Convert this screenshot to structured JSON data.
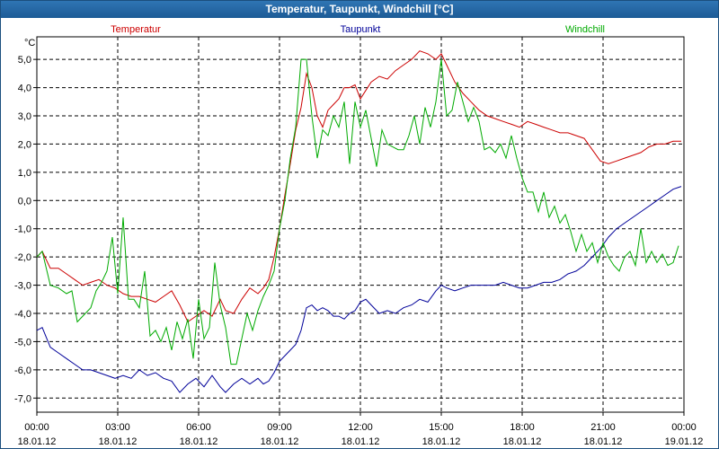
{
  "window": {
    "title": "Temperatur, Taupunkt, Windchill [°C]"
  },
  "chart_data": {
    "type": "line",
    "title": "Temperatur, Taupunkt, Windchill [°C]",
    "ylabel": "°C",
    "ylim": [
      -7.5,
      5.8
    ],
    "yticks": [
      {
        "v": 5,
        "label": "5,0"
      },
      {
        "v": 4,
        "label": "4,0"
      },
      {
        "v": 3,
        "label": "3,0"
      },
      {
        "v": 2,
        "label": "2,0"
      },
      {
        "v": 1,
        "label": "1,0"
      },
      {
        "v": 0,
        "label": "0,0"
      },
      {
        "v": -1,
        "label": "-1,0"
      },
      {
        "v": -2,
        "label": "-2,0"
      },
      {
        "v": -3,
        "label": "-3,0"
      },
      {
        "v": -4,
        "label": "-4,0"
      },
      {
        "v": -5,
        "label": "-5,0"
      },
      {
        "v": -6,
        "label": "-6,0"
      },
      {
        "v": -7,
        "label": "-7,0"
      }
    ],
    "xlim": [
      0,
      24
    ],
    "xticks": [
      {
        "v": 0,
        "time": "00:00",
        "date": "18.01.12"
      },
      {
        "v": 3,
        "time": "03:00",
        "date": "18.01.12"
      },
      {
        "v": 6,
        "time": "06:00",
        "date": "18.01.12"
      },
      {
        "v": 9,
        "time": "09:00",
        "date": "18.01.12"
      },
      {
        "v": 12,
        "time": "12:00",
        "date": "18.01.12"
      },
      {
        "v": 15,
        "time": "15:00",
        "date": "18.01.12"
      },
      {
        "v": 18,
        "time": "18:00",
        "date": "18.01.12"
      },
      {
        "v": 21,
        "time": "21:00",
        "date": "18.01.12"
      },
      {
        "v": 24,
        "time": "00:00",
        "date": "19.01.12"
      }
    ],
    "grid": true,
    "legend": "top",
    "series": [
      {
        "name": "Temperatur",
        "color": "#cc0000",
        "points": [
          [
            0,
            -2.0
          ],
          [
            0.2,
            -1.8
          ],
          [
            0.5,
            -2.4
          ],
          [
            0.8,
            -2.4
          ],
          [
            1.1,
            -2.6
          ],
          [
            1.4,
            -2.8
          ],
          [
            1.7,
            -3.0
          ],
          [
            2.0,
            -2.9
          ],
          [
            2.3,
            -2.8
          ],
          [
            2.6,
            -3.0
          ],
          [
            2.9,
            -3.1
          ],
          [
            3.2,
            -3.3
          ],
          [
            3.5,
            -3.4
          ],
          [
            3.8,
            -3.4
          ],
          [
            4.1,
            -3.5
          ],
          [
            4.4,
            -3.6
          ],
          [
            4.7,
            -3.4
          ],
          [
            5.0,
            -3.2
          ],
          [
            5.3,
            -3.7
          ],
          [
            5.6,
            -4.3
          ],
          [
            5.9,
            -4.1
          ],
          [
            6.2,
            -3.9
          ],
          [
            6.5,
            -4.1
          ],
          [
            6.8,
            -3.5
          ],
          [
            7.0,
            -3.9
          ],
          [
            7.3,
            -4.0
          ],
          [
            7.6,
            -3.5
          ],
          [
            7.9,
            -3.1
          ],
          [
            8.2,
            -3.3
          ],
          [
            8.4,
            -3.1
          ],
          [
            8.6,
            -2.8
          ],
          [
            8.8,
            -2.0
          ],
          [
            9.0,
            -1.0
          ],
          [
            9.2,
            0.2
          ],
          [
            9.4,
            1.3
          ],
          [
            9.6,
            2.5
          ],
          [
            9.8,
            3.3
          ],
          [
            10.0,
            4.5
          ],
          [
            10.2,
            4.0
          ],
          [
            10.4,
            3.0
          ],
          [
            10.6,
            2.6
          ],
          [
            10.8,
            3.2
          ],
          [
            11.0,
            3.4
          ],
          [
            11.2,
            3.6
          ],
          [
            11.4,
            4.0
          ],
          [
            11.6,
            4.0
          ],
          [
            11.8,
            4.1
          ],
          [
            12.0,
            3.6
          ],
          [
            12.2,
            3.9
          ],
          [
            12.4,
            4.2
          ],
          [
            12.7,
            4.4
          ],
          [
            13.0,
            4.3
          ],
          [
            13.3,
            4.6
          ],
          [
            13.6,
            4.8
          ],
          [
            13.9,
            5.0
          ],
          [
            14.2,
            5.3
          ],
          [
            14.5,
            5.2
          ],
          [
            14.8,
            5.0
          ],
          [
            15.0,
            5.2
          ],
          [
            15.2,
            4.8
          ],
          [
            15.5,
            4.2
          ],
          [
            15.8,
            3.8
          ],
          [
            16.1,
            3.5
          ],
          [
            16.4,
            3.2
          ],
          [
            16.7,
            3.0
          ],
          [
            17.0,
            2.9
          ],
          [
            17.3,
            2.8
          ],
          [
            17.6,
            2.7
          ],
          [
            17.9,
            2.6
          ],
          [
            18.2,
            2.8
          ],
          [
            18.5,
            2.7
          ],
          [
            18.8,
            2.6
          ],
          [
            19.1,
            2.5
          ],
          [
            19.4,
            2.4
          ],
          [
            19.7,
            2.4
          ],
          [
            20.0,
            2.3
          ],
          [
            20.3,
            2.2
          ],
          [
            20.6,
            1.8
          ],
          [
            20.9,
            1.4
          ],
          [
            21.2,
            1.3
          ],
          [
            21.5,
            1.4
          ],
          [
            21.8,
            1.5
          ],
          [
            22.1,
            1.6
          ],
          [
            22.4,
            1.7
          ],
          [
            22.7,
            1.9
          ],
          [
            23.0,
            2.0
          ],
          [
            23.3,
            2.0
          ],
          [
            23.6,
            2.1
          ],
          [
            23.9,
            2.1
          ]
        ]
      },
      {
        "name": "Taupunkt",
        "color": "#000099",
        "points": [
          [
            0,
            -4.6
          ],
          [
            0.2,
            -4.5
          ],
          [
            0.5,
            -5.2
          ],
          [
            0.8,
            -5.4
          ],
          [
            1.1,
            -5.6
          ],
          [
            1.4,
            -5.8
          ],
          [
            1.7,
            -6.0
          ],
          [
            2.0,
            -6.0
          ],
          [
            2.3,
            -6.1
          ],
          [
            2.6,
            -6.2
          ],
          [
            2.9,
            -6.3
          ],
          [
            3.2,
            -6.2
          ],
          [
            3.5,
            -6.3
          ],
          [
            3.8,
            -6.0
          ],
          [
            4.1,
            -6.2
          ],
          [
            4.4,
            -6.1
          ],
          [
            4.7,
            -6.3
          ],
          [
            5.0,
            -6.4
          ],
          [
            5.3,
            -6.8
          ],
          [
            5.6,
            -6.5
          ],
          [
            5.9,
            -6.3
          ],
          [
            6.2,
            -6.6
          ],
          [
            6.5,
            -6.2
          ],
          [
            6.8,
            -6.6
          ],
          [
            7.0,
            -6.8
          ],
          [
            7.3,
            -6.5
          ],
          [
            7.6,
            -6.3
          ],
          [
            7.9,
            -6.5
          ],
          [
            8.2,
            -6.3
          ],
          [
            8.4,
            -6.5
          ],
          [
            8.6,
            -6.4
          ],
          [
            8.8,
            -6.1
          ],
          [
            9.0,
            -5.7
          ],
          [
            9.2,
            -5.5
          ],
          [
            9.4,
            -5.3
          ],
          [
            9.6,
            -5.1
          ],
          [
            9.8,
            -4.6
          ],
          [
            10.0,
            -3.8
          ],
          [
            10.2,
            -3.7
          ],
          [
            10.4,
            -3.9
          ],
          [
            10.6,
            -3.8
          ],
          [
            10.8,
            -3.9
          ],
          [
            11.0,
            -4.1
          ],
          [
            11.2,
            -4.1
          ],
          [
            11.4,
            -4.2
          ],
          [
            11.6,
            -4.0
          ],
          [
            11.8,
            -3.9
          ],
          [
            12.0,
            -3.6
          ],
          [
            12.2,
            -3.5
          ],
          [
            12.4,
            -3.7
          ],
          [
            12.7,
            -4.0
          ],
          [
            13.0,
            -3.9
          ],
          [
            13.3,
            -4.0
          ],
          [
            13.6,
            -3.8
          ],
          [
            13.9,
            -3.7
          ],
          [
            14.2,
            -3.5
          ],
          [
            14.5,
            -3.6
          ],
          [
            14.8,
            -3.2
          ],
          [
            15.0,
            -3.0
          ],
          [
            15.2,
            -3.1
          ],
          [
            15.5,
            -3.2
          ],
          [
            15.8,
            -3.1
          ],
          [
            16.1,
            -3.0
          ],
          [
            16.4,
            -3.0
          ],
          [
            16.7,
            -3.0
          ],
          [
            17.0,
            -3.0
          ],
          [
            17.3,
            -2.9
          ],
          [
            17.6,
            -3.0
          ],
          [
            17.9,
            -3.1
          ],
          [
            18.2,
            -3.1
          ],
          [
            18.5,
            -3.0
          ],
          [
            18.8,
            -2.9
          ],
          [
            19.1,
            -2.9
          ],
          [
            19.4,
            -2.8
          ],
          [
            19.7,
            -2.6
          ],
          [
            20.0,
            -2.5
          ],
          [
            20.3,
            -2.3
          ],
          [
            20.6,
            -2.0
          ],
          [
            20.9,
            -1.7
          ],
          [
            21.2,
            -1.3
          ],
          [
            21.5,
            -1.0
          ],
          [
            21.8,
            -0.8
          ],
          [
            22.1,
            -0.6
          ],
          [
            22.4,
            -0.4
          ],
          [
            22.7,
            -0.2
          ],
          [
            23.0,
            0.0
          ],
          [
            23.3,
            0.2
          ],
          [
            23.6,
            0.4
          ],
          [
            23.9,
            0.5
          ]
        ]
      },
      {
        "name": "Windchill",
        "color": "#00aa00",
        "points": [
          [
            0,
            -2.0
          ],
          [
            0.2,
            -1.8
          ],
          [
            0.5,
            -3.0
          ],
          [
            0.8,
            -3.1
          ],
          [
            1.1,
            -3.3
          ],
          [
            1.3,
            -3.2
          ],
          [
            1.5,
            -4.3
          ],
          [
            1.8,
            -4.0
          ],
          [
            2.0,
            -3.8
          ],
          [
            2.2,
            -3.2
          ],
          [
            2.4,
            -2.9
          ],
          [
            2.6,
            -2.5
          ],
          [
            2.8,
            -1.3
          ],
          [
            3.0,
            -3.3
          ],
          [
            3.2,
            -0.6
          ],
          [
            3.4,
            -3.5
          ],
          [
            3.6,
            -3.5
          ],
          [
            3.8,
            -3.8
          ],
          [
            4.0,
            -2.5
          ],
          [
            4.2,
            -4.8
          ],
          [
            4.4,
            -4.6
          ],
          [
            4.6,
            -5.0
          ],
          [
            4.8,
            -4.5
          ],
          [
            5.0,
            -5.3
          ],
          [
            5.2,
            -4.3
          ],
          [
            5.4,
            -4.9
          ],
          [
            5.6,
            -4.2
          ],
          [
            5.8,
            -5.6
          ],
          [
            6.0,
            -3.5
          ],
          [
            6.2,
            -4.9
          ],
          [
            6.4,
            -4.5
          ],
          [
            6.6,
            -2.2
          ],
          [
            6.8,
            -3.7
          ],
          [
            7.0,
            -4.5
          ],
          [
            7.2,
            -5.8
          ],
          [
            7.4,
            -5.8
          ],
          [
            7.6,
            -4.9
          ],
          [
            7.8,
            -4.0
          ],
          [
            8.0,
            -4.6
          ],
          [
            8.2,
            -3.9
          ],
          [
            8.4,
            -3.4
          ],
          [
            8.6,
            -3.0
          ],
          [
            8.8,
            -2.5
          ],
          [
            9.0,
            -1.0
          ],
          [
            9.2,
            0.0
          ],
          [
            9.4,
            1.5
          ],
          [
            9.6,
            2.6
          ],
          [
            9.8,
            5.0
          ],
          [
            10.0,
            5.0
          ],
          [
            10.2,
            3.0
          ],
          [
            10.4,
            1.5
          ],
          [
            10.6,
            2.5
          ],
          [
            10.8,
            2.3
          ],
          [
            11.0,
            3.0
          ],
          [
            11.2,
            2.6
          ],
          [
            11.4,
            3.5
          ],
          [
            11.6,
            1.3
          ],
          [
            11.8,
            3.5
          ],
          [
            12.0,
            2.6
          ],
          [
            12.2,
            3.2
          ],
          [
            12.4,
            2.2
          ],
          [
            12.6,
            1.2
          ],
          [
            12.8,
            2.5
          ],
          [
            13.0,
            2.0
          ],
          [
            13.2,
            1.9
          ],
          [
            13.4,
            1.8
          ],
          [
            13.6,
            1.8
          ],
          [
            13.8,
            2.3
          ],
          [
            14.0,
            3.0
          ],
          [
            14.2,
            2.0
          ],
          [
            14.4,
            3.3
          ],
          [
            14.6,
            2.6
          ],
          [
            14.8,
            3.5
          ],
          [
            15.0,
            5.0
          ],
          [
            15.2,
            3.0
          ],
          [
            15.4,
            3.2
          ],
          [
            15.6,
            4.2
          ],
          [
            15.8,
            3.5
          ],
          [
            16.0,
            2.8
          ],
          [
            16.2,
            3.3
          ],
          [
            16.4,
            2.8
          ],
          [
            16.6,
            1.8
          ],
          [
            16.8,
            1.9
          ],
          [
            17.0,
            1.7
          ],
          [
            17.2,
            2.0
          ],
          [
            17.4,
            1.5
          ],
          [
            17.6,
            2.3
          ],
          [
            17.8,
            1.5
          ],
          [
            18.0,
            0.8
          ],
          [
            18.2,
            0.3
          ],
          [
            18.4,
            0.3
          ],
          [
            18.6,
            -0.4
          ],
          [
            18.8,
            0.3
          ],
          [
            19.0,
            -0.6
          ],
          [
            19.2,
            -0.2
          ],
          [
            19.4,
            -0.8
          ],
          [
            19.6,
            -0.5
          ],
          [
            19.8,
            -1.1
          ],
          [
            20.0,
            -1.8
          ],
          [
            20.2,
            -1.2
          ],
          [
            20.4,
            -1.8
          ],
          [
            20.6,
            -1.5
          ],
          [
            20.8,
            -2.2
          ],
          [
            21.0,
            -1.5
          ],
          [
            21.2,
            -2.0
          ],
          [
            21.4,
            -2.3
          ],
          [
            21.6,
            -2.5
          ],
          [
            21.8,
            -2.0
          ],
          [
            22.0,
            -1.8
          ],
          [
            22.2,
            -2.3
          ],
          [
            22.4,
            -1.0
          ],
          [
            22.6,
            -2.2
          ],
          [
            22.8,
            -1.8
          ],
          [
            23.0,
            -2.2
          ],
          [
            23.2,
            -1.9
          ],
          [
            23.4,
            -2.3
          ],
          [
            23.6,
            -2.2
          ],
          [
            23.8,
            -1.6
          ]
        ]
      }
    ]
  }
}
